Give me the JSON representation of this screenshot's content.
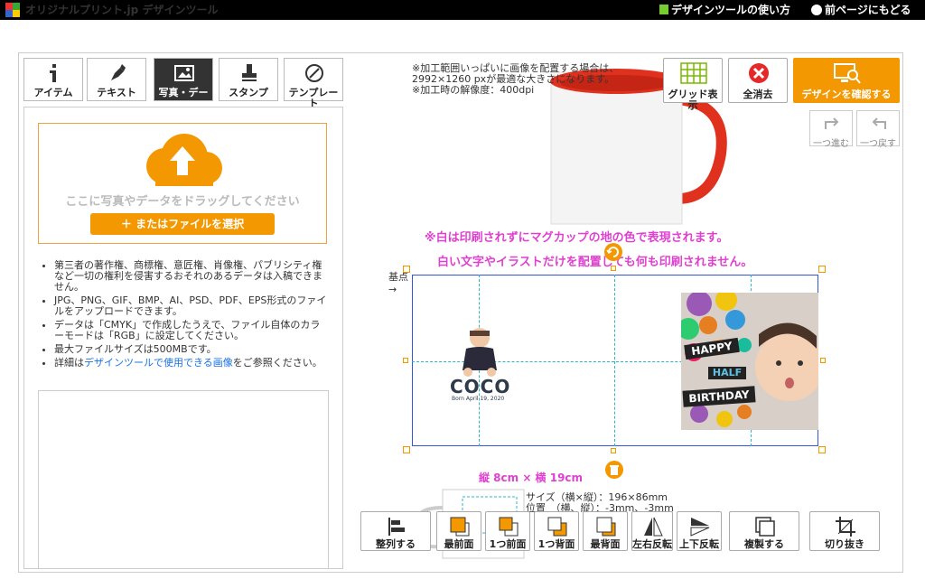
{
  "header": {
    "title": "オリジナルプリント.jp デザインツール",
    "help_link": "デザインツールの使い方",
    "back_link": "前ページにもどる"
  },
  "tabs": [
    {
      "label": "アイテム",
      "icon": "info-icon",
      "active": false
    },
    {
      "label": "テキスト",
      "icon": "pen-icon",
      "active": false
    },
    {
      "label": "写真・デー",
      "icon": "image-icon",
      "active": true
    },
    {
      "label": "スタンプ",
      "icon": "stamp-icon",
      "active": false
    },
    {
      "label": "テンプレート",
      "icon": "template-icon",
      "active": false
    }
  ],
  "upload": {
    "drop_text": "ここに写真やデータをドラッグしてください",
    "button_label": "＋ またはファイルを選択"
  },
  "notes": [
    "第三者の著作権、商標権、意匠権、肖像権、パブリシティ権など一切の権利を侵害するおそれのあるデータは入稿できません。",
    "JPG、PNG、GIF、BMP、AI、PSD、PDF、EPS形式のファイルをアップロードできます。",
    "データは「CMYK」で作成したうえで、ファイル自体のカラーモードは「RGB」に設定してください。",
    "最大ファイルサイズは500MBです。"
  ],
  "notes_link": {
    "prefix": "詳細は",
    "link": "デザインツールで使用できる画像",
    "suffix": "をご参照ください。"
  },
  "info_text": [
    "※加工範囲いっぱいに画像を配置する場合は、",
    "2992×1260 pxが最適な大きさになります。",
    "※加工時の解像度：400dpi"
  ],
  "top_buttons": {
    "grid": "グリッド表示",
    "clear": "全消去",
    "confirm": "デザインを確認する"
  },
  "history": {
    "redo": "一つ進む",
    "undo": "一つ戻す"
  },
  "warnings": {
    "line1": "※白は印刷されずにマグカップの地の色で表現されます。",
    "line2": "白い文字やイラストだけを配置しても何も印刷されません。"
  },
  "baseline_label": "基点",
  "artwork": {
    "coco_title": "COCO",
    "coco_sub": "Born April 19, 2020",
    "happy": "HAPPY",
    "half": "HALF",
    "birthday": "BIRTHDAY"
  },
  "size_label": "縦 8cm × 横 19cm",
  "dims": {
    "size": "サイズ（横×縦）：196×86mm",
    "position": "位置　（横、縦）：-3mm、-3mm"
  },
  "bottom_buttons": [
    {
      "label": "整列する",
      "name": "align-button"
    },
    {
      "label": "最前面",
      "name": "bring-front-button"
    },
    {
      "label": "1つ前面",
      "name": "bring-forward-button"
    },
    {
      "label": "1つ背面",
      "name": "send-backward-button"
    },
    {
      "label": "最背面",
      "name": "send-back-button"
    },
    {
      "label": "左右反転",
      "name": "flip-horizontal-button"
    },
    {
      "label": "上下反転",
      "name": "flip-vertical-button"
    },
    {
      "label": "複製する",
      "name": "duplicate-button"
    },
    {
      "label": "切り抜き",
      "name": "crop-button"
    }
  ],
  "colors": {
    "accent": "#f39800",
    "warning": "#e040d0",
    "guide": "#2bb5c8",
    "mug_inner": "#e0301e"
  }
}
